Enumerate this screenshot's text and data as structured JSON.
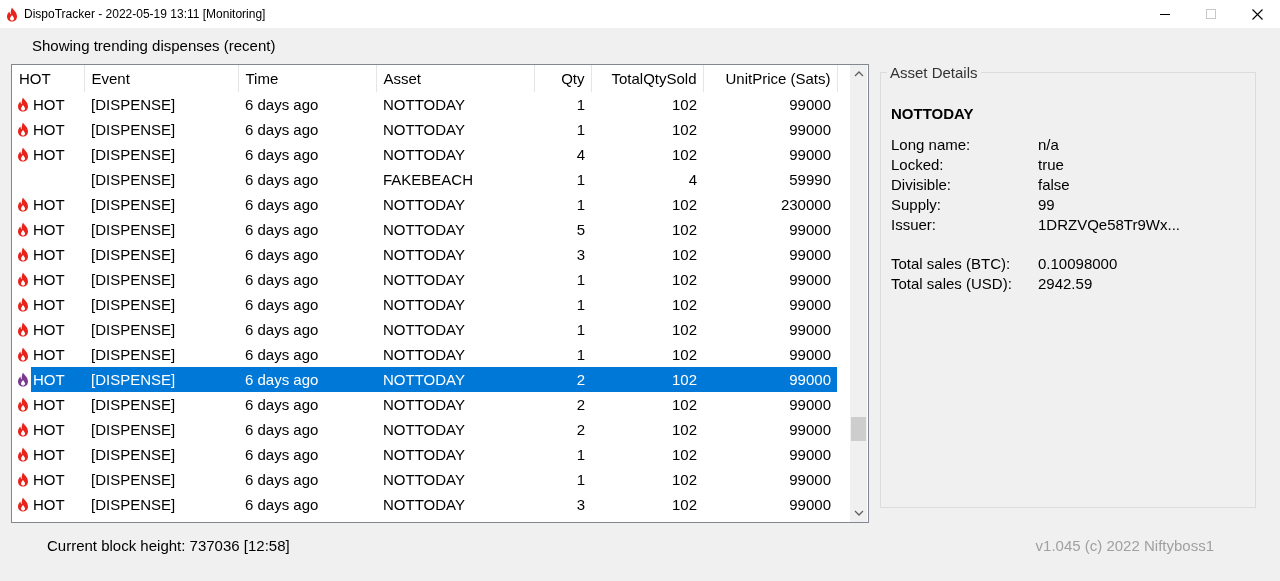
{
  "window": {
    "title": "DispoTracker - 2022-05-19 13:11 [Monitoring]"
  },
  "heading": "Showing trending dispenses (recent)",
  "table": {
    "columns": [
      "HOT",
      "Event",
      "Time",
      "Asset",
      "Qty",
      "TotalQtySold",
      "UnitPrice (Sats)"
    ],
    "rows": [
      {
        "hot": true,
        "selected": false,
        "cells": [
          "HOT",
          "[DISPENSE]",
          "6 days ago",
          "NOTTODAY",
          "1",
          "102",
          "99000"
        ]
      },
      {
        "hot": true,
        "selected": false,
        "cells": [
          "HOT",
          "[DISPENSE]",
          "6 days ago",
          "NOTTODAY",
          "1",
          "102",
          "99000"
        ]
      },
      {
        "hot": true,
        "selected": false,
        "cells": [
          "HOT",
          "[DISPENSE]",
          "6 days ago",
          "NOTTODAY",
          "4",
          "102",
          "99000"
        ]
      },
      {
        "hot": false,
        "selected": false,
        "cells": [
          "",
          "[DISPENSE]",
          "6 days ago",
          "FAKEBEACH",
          "1",
          "4",
          "59990"
        ]
      },
      {
        "hot": true,
        "selected": false,
        "cells": [
          "HOT",
          "[DISPENSE]",
          "6 days ago",
          "NOTTODAY",
          "1",
          "102",
          "230000"
        ]
      },
      {
        "hot": true,
        "selected": false,
        "cells": [
          "HOT",
          "[DISPENSE]",
          "6 days ago",
          "NOTTODAY",
          "5",
          "102",
          "99000"
        ]
      },
      {
        "hot": true,
        "selected": false,
        "cells": [
          "HOT",
          "[DISPENSE]",
          "6 days ago",
          "NOTTODAY",
          "3",
          "102",
          "99000"
        ]
      },
      {
        "hot": true,
        "selected": false,
        "cells": [
          "HOT",
          "[DISPENSE]",
          "6 days ago",
          "NOTTODAY",
          "1",
          "102",
          "99000"
        ]
      },
      {
        "hot": true,
        "selected": false,
        "cells": [
          "HOT",
          "[DISPENSE]",
          "6 days ago",
          "NOTTODAY",
          "1",
          "102",
          "99000"
        ]
      },
      {
        "hot": true,
        "selected": false,
        "cells": [
          "HOT",
          "[DISPENSE]",
          "6 days ago",
          "NOTTODAY",
          "1",
          "102",
          "99000"
        ]
      },
      {
        "hot": true,
        "selected": false,
        "cells": [
          "HOT",
          "[DISPENSE]",
          "6 days ago",
          "NOTTODAY",
          "1",
          "102",
          "99000"
        ]
      },
      {
        "hot": true,
        "selected": true,
        "cells": [
          "HOT",
          "[DISPENSE]",
          "6 days ago",
          "NOTTODAY",
          "2",
          "102",
          "99000"
        ]
      },
      {
        "hot": true,
        "selected": false,
        "cells": [
          "HOT",
          "[DISPENSE]",
          "6 days ago",
          "NOTTODAY",
          "2",
          "102",
          "99000"
        ]
      },
      {
        "hot": true,
        "selected": false,
        "cells": [
          "HOT",
          "[DISPENSE]",
          "6 days ago",
          "NOTTODAY",
          "2",
          "102",
          "99000"
        ]
      },
      {
        "hot": true,
        "selected": false,
        "cells": [
          "HOT",
          "[DISPENSE]",
          "6 days ago",
          "NOTTODAY",
          "1",
          "102",
          "99000"
        ]
      },
      {
        "hot": true,
        "selected": false,
        "cells": [
          "HOT",
          "[DISPENSE]",
          "6 days ago",
          "NOTTODAY",
          "1",
          "102",
          "99000"
        ]
      },
      {
        "hot": true,
        "selected": false,
        "cells": [
          "HOT",
          "[DISPENSE]",
          "6 days ago",
          "NOTTODAY",
          "3",
          "102",
          "99000"
        ]
      }
    ]
  },
  "asset_details": {
    "title": "Asset Details",
    "asset": "NOTTODAY",
    "fields": [
      {
        "label": "Long name:",
        "value": "n/a"
      },
      {
        "label": "Locked:",
        "value": "true"
      },
      {
        "label": "Divisible:",
        "value": "false"
      },
      {
        "label": "Supply:",
        "value": "99"
      },
      {
        "label": "Issuer:",
        "value": "1DRZVQe58Tr9Wx..."
      }
    ],
    "totals": [
      {
        "label": "Total sales (BTC):",
        "value": "0.10098000"
      },
      {
        "label": "Total sales (USD):",
        "value": "2942.59"
      }
    ]
  },
  "status_bar": {
    "block_height": "Current block height: 737036 [12:58]",
    "version": "v1.045 (c) 2022 Niftyboss1"
  }
}
